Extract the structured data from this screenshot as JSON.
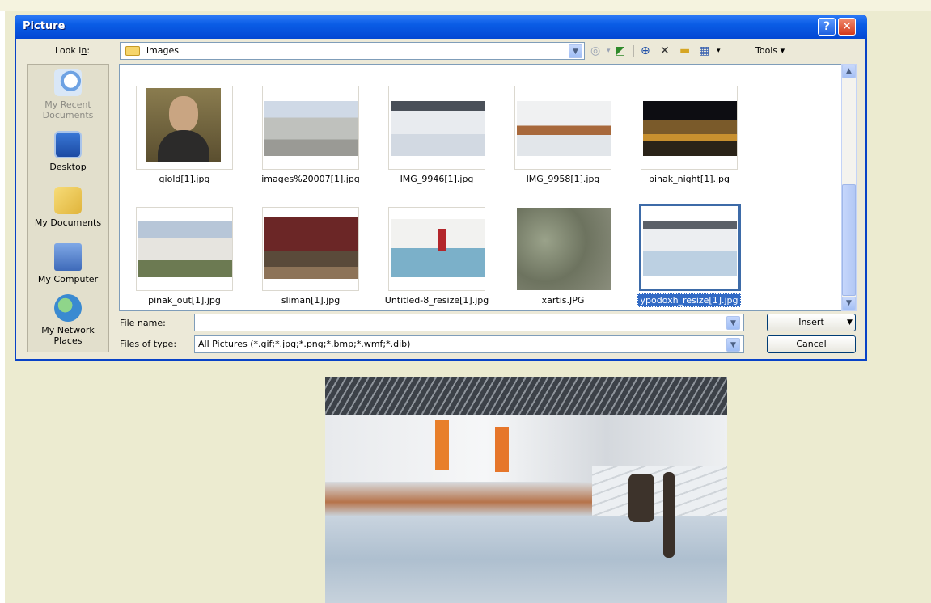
{
  "dialog": {
    "title": "Picture",
    "help_glyph": "?",
    "close_glyph": "✕",
    "look_in_label": "Look in:",
    "look_in_value": "images",
    "tools_label": "Tools",
    "file_name_label": "File name:",
    "file_name_value": "",
    "files_of_type_label": "Files of type:",
    "files_of_type_value": "All Pictures (*.gif;*.jpg;*.png;*.bmp;*.wmf;*.dib)",
    "insert_label": "Insert",
    "cancel_label": "Cancel"
  },
  "places": [
    {
      "label": "My Recent Documents",
      "icon": "recent-documents-icon",
      "enabled": false
    },
    {
      "label": "Desktop",
      "icon": "desktop-icon",
      "enabled": true
    },
    {
      "label": "My Documents",
      "icon": "my-documents-icon",
      "enabled": true
    },
    {
      "label": "My Computer",
      "icon": "my-computer-icon",
      "enabled": true
    },
    {
      "label": "My Network Places",
      "icon": "my-network-places-icon",
      "enabled": true
    }
  ],
  "files": [
    {
      "name": "giold[1].jpg",
      "selected": false
    },
    {
      "name": "images%20007[1].jpg",
      "selected": false
    },
    {
      "name": "IMG_9946[1].jpg",
      "selected": false
    },
    {
      "name": "IMG_9958[1].jpg",
      "selected": false
    },
    {
      "name": "pinak_night[1].jpg",
      "selected": false
    },
    {
      "name": "pinak_out[1].jpg",
      "selected": false
    },
    {
      "name": "sliman[1].jpg",
      "selected": false
    },
    {
      "name": "Untitled-8_resize[1].jpg",
      "selected": false
    },
    {
      "name": "xartis.JPG",
      "selected": false
    },
    {
      "name": "ypodoxh_resize[1].jpg",
      "selected": true
    }
  ],
  "colors": {
    "titlebar": "#0a5de6",
    "selection": "#316ac5",
    "dialog_bg": "#ece9d8",
    "page_bg": "#ecebd0"
  }
}
